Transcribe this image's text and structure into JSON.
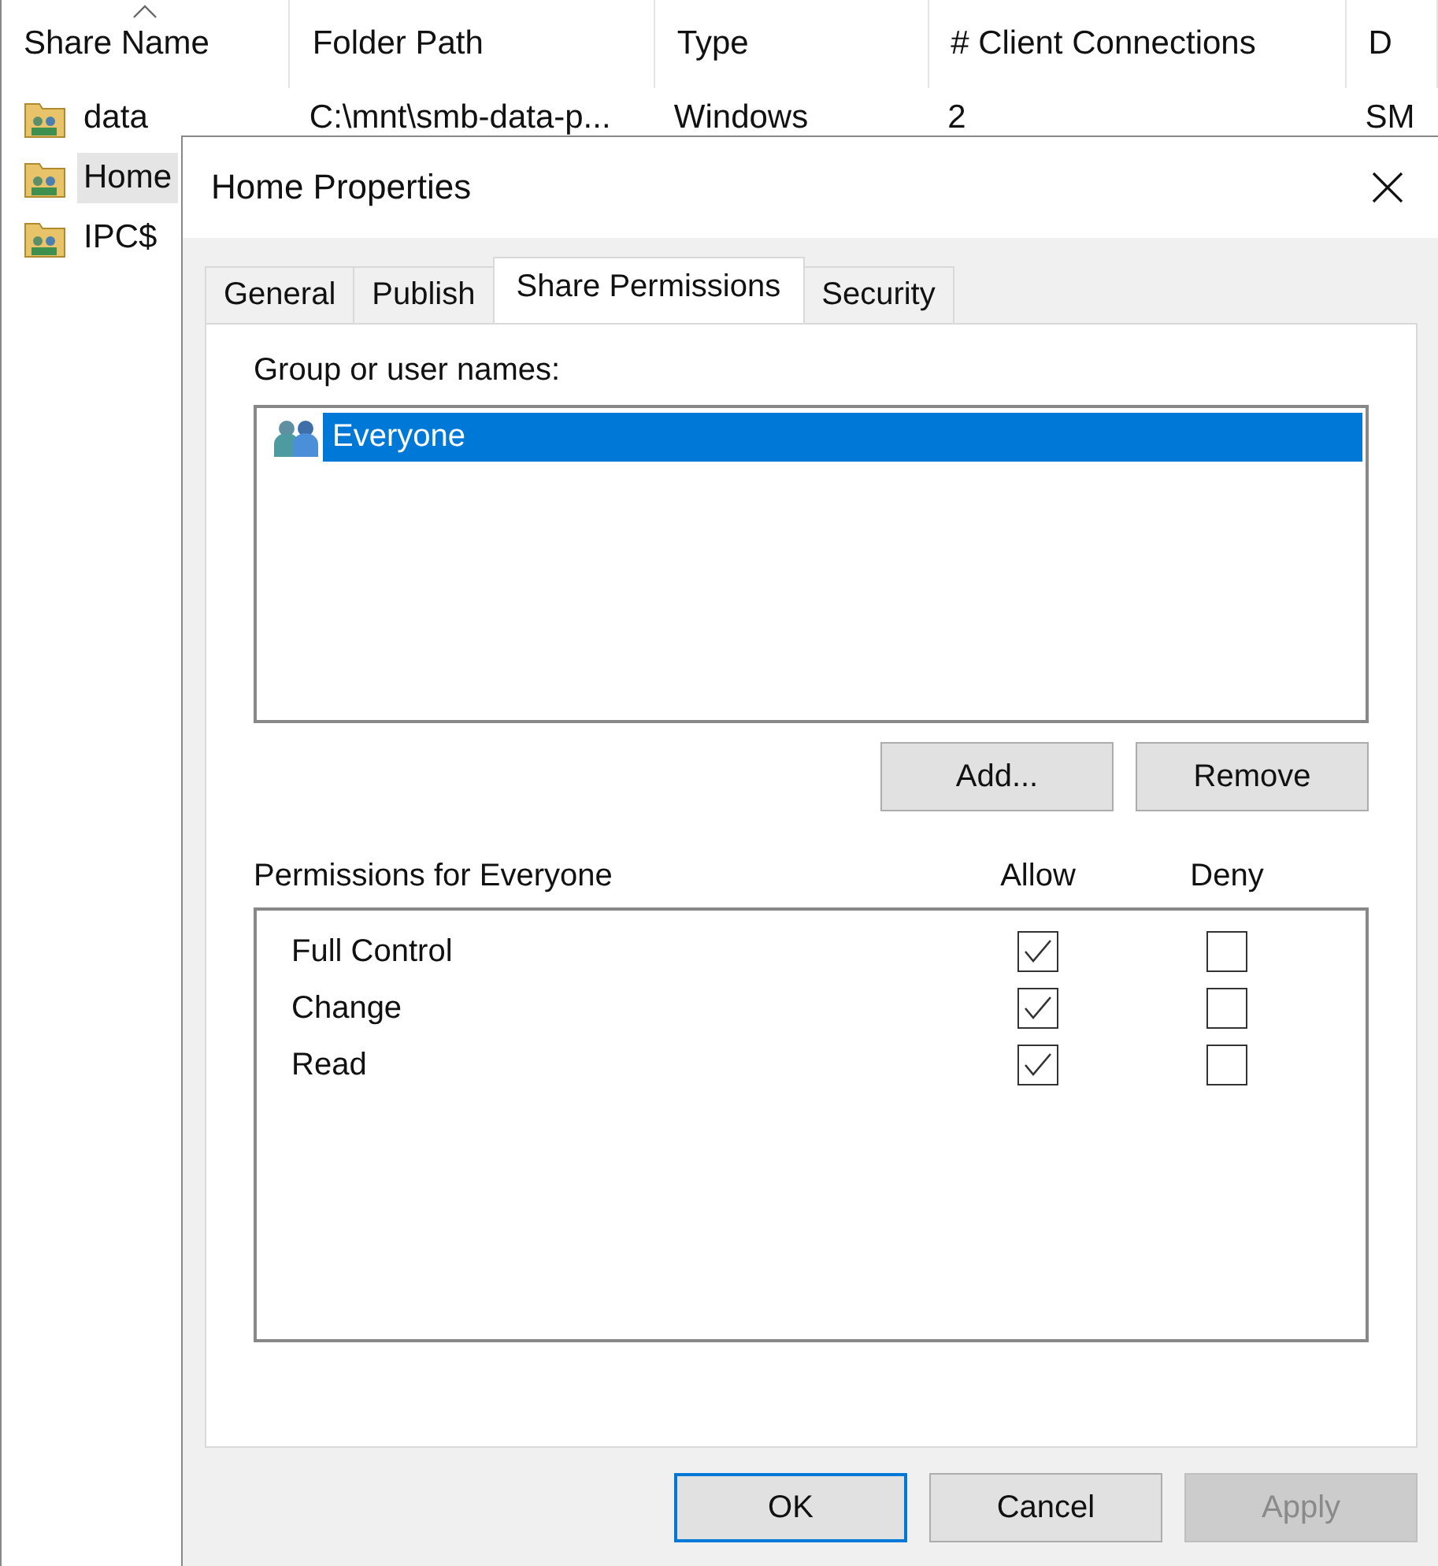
{
  "share_list": {
    "columns": [
      {
        "label": "Share Name",
        "sorted": true
      },
      {
        "label": "Folder Path",
        "sorted": false
      },
      {
        "label": "Type",
        "sorted": false
      },
      {
        "label": "# Client Connections",
        "sorted": false
      },
      {
        "label": "D",
        "sorted": false
      }
    ],
    "rows": [
      {
        "selected": false,
        "cells": [
          "data",
          "C:\\mnt\\smb-data-p...",
          "Windows",
          "2",
          "SM"
        ]
      },
      {
        "selected": true,
        "cells": [
          "Home"
        ]
      },
      {
        "selected": false,
        "cells": [
          "IPC$"
        ]
      }
    ]
  },
  "dialog": {
    "title": "Home Properties",
    "tabs": [
      {
        "label": "General",
        "selected": false
      },
      {
        "label": "Publish",
        "selected": false
      },
      {
        "label": "Share Permissions",
        "selected": true
      },
      {
        "label": "Security",
        "selected": false
      }
    ],
    "group_label": "Group or user names:",
    "users": [
      {
        "name": "Everyone",
        "selected": true
      }
    ],
    "user_buttons": [
      {
        "label": "Add...",
        "disabled": false
      },
      {
        "label": "Remove",
        "disabled": false
      }
    ],
    "permissions_label": "Permissions for Everyone",
    "allow_label": "Allow",
    "deny_label": "Deny",
    "permissions": [
      {
        "name": "Full Control",
        "allow": true,
        "deny": false
      },
      {
        "name": "Change",
        "allow": true,
        "deny": false
      },
      {
        "name": "Read",
        "allow": true,
        "deny": false
      }
    ],
    "buttons": [
      {
        "label": "OK",
        "default": true,
        "disabled": false
      },
      {
        "label": "Cancel",
        "default": false,
        "disabled": false
      },
      {
        "label": "Apply",
        "default": false,
        "disabled": true
      }
    ]
  }
}
